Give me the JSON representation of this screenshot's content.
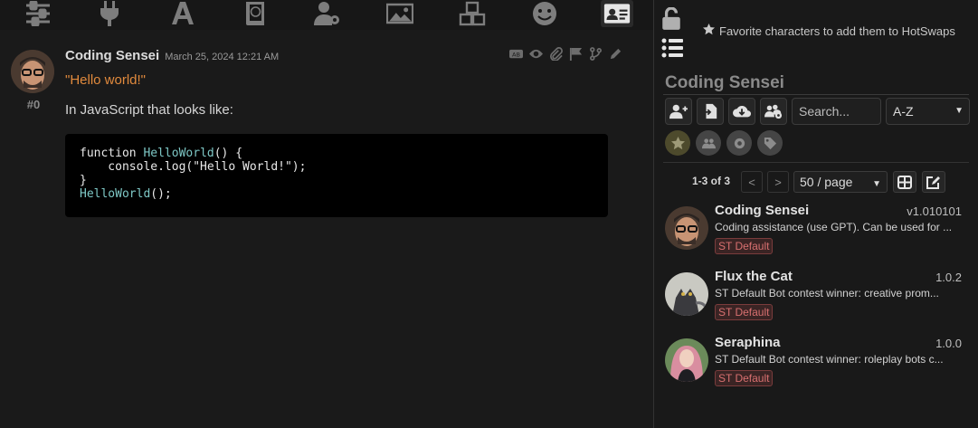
{
  "topbar": {
    "icons": [
      "sliders-icon",
      "plug-icon",
      "font-icon",
      "book-globe-icon",
      "user-gear-icon",
      "image-icon",
      "cubes-icon",
      "smile-icon",
      "id-card-icon"
    ]
  },
  "message": {
    "name": "Coding Sensei",
    "date": "March 25, 2024 12:21 AM",
    "id": "#0",
    "quote": "\"Hello world!\"",
    "paragraph": "In JavaScript that looks like:",
    "code_line1_a": "function ",
    "code_line1_fn": "HelloWorld",
    "code_line1_b": "() {",
    "code_line2": "    console.log(\"Hello World!\");",
    "code_line3": "}",
    "code_line4_fn": "HelloWorld",
    "code_line4_b": "();"
  },
  "panel": {
    "favorite_hint": "Favorite characters to add them to HotSwaps",
    "title": "Coding Sensei",
    "search_placeholder": "Search...",
    "sort_value": "A-Z",
    "pagination_info": "1-3 of 3",
    "prev": "<",
    "next": ">",
    "page_size": "50 / page",
    "characters": [
      {
        "name": "Coding Sensei",
        "version": "v1.010101",
        "desc": "Coding assistance (use GPT). Can be used for ...",
        "tag": "ST Default"
      },
      {
        "name": "Flux the Cat",
        "version": "1.0.2",
        "desc": "ST Default Bot contest winner: creative prom...",
        "tag": "ST Default"
      },
      {
        "name": "Seraphina",
        "version": "1.0.0",
        "desc": "ST Default Bot contest winner: roleplay bots c...",
        "tag": "ST Default"
      }
    ]
  }
}
